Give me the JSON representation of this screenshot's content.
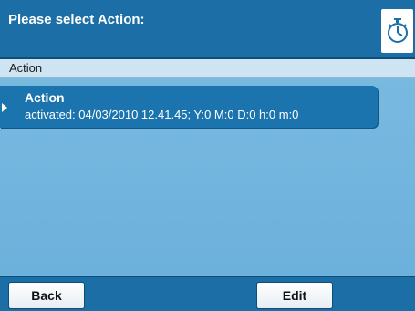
{
  "header": {
    "title": "Please select Action:",
    "timer_icon": "stopwatch-icon"
  },
  "subheader": {
    "label": "Action"
  },
  "list": {
    "items": [
      {
        "title": "Action",
        "detail": "activated: 04/03/2010 12.41.45; Y:0 M:0 D:0 h:0 m:0"
      }
    ]
  },
  "footer": {
    "back_label": "Back",
    "edit_label": "Edit"
  },
  "colors": {
    "header_bg": "#1b6fa6",
    "content_bg": "#6fb3dc",
    "item_bg": "#1b74ad"
  }
}
